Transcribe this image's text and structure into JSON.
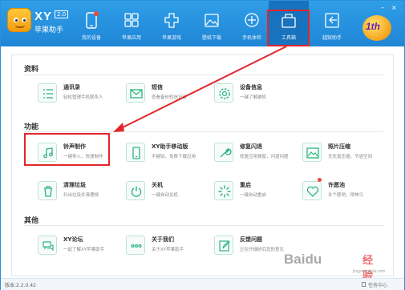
{
  "app": {
    "name": "XY",
    "version_badge": "2.0",
    "subtitle": "苹果助手",
    "mascot_text": "1th"
  },
  "nav": [
    {
      "label": "我的设备",
      "icon": "phone-icon"
    },
    {
      "label": "苹果应用",
      "icon": "apps-grid-icon"
    },
    {
      "label": "苹果游戏",
      "icon": "game-cross-icon"
    },
    {
      "label": "壁纸下载",
      "icon": "wallpaper-icon"
    },
    {
      "label": "手机体检",
      "icon": "plus-circle-icon"
    },
    {
      "label": "工具箱",
      "icon": "toolbox-icon",
      "active": true
    },
    {
      "label": "越狱助手",
      "icon": "jailbreak-icon"
    }
  ],
  "sections": {
    "data": "资料",
    "functions": "功能",
    "other": "其他"
  },
  "tiles": {
    "contacts": {
      "title": "通讯录",
      "desc": "轻松管理手机联系人",
      "icon": "list-icon"
    },
    "sms": {
      "title": "短信",
      "desc": "查看备份短信记录",
      "icon": "envelope-icon"
    },
    "device_info": {
      "title": "设备信息",
      "desc": "一键了解硬机",
      "icon": "gear-icon"
    },
    "ringtone": {
      "title": "铃声制作",
      "desc": "一键导入，快速制作",
      "icon": "music-note-icon"
    },
    "xy_mobile": {
      "title": "XY助手移动版",
      "desc": "不越狱，免费下载应用",
      "icon": "mobile-icon"
    },
    "repair": {
      "title": "修复闪退",
      "desc": "修复应用弹窗，闪退问题",
      "icon": "wrench-icon"
    },
    "photo_compress": {
      "title": "照片压缩",
      "desc": "无失真压缩，节省空间",
      "icon": "photo-icon"
    },
    "cleanup": {
      "title": "清理垃圾",
      "desc": "扫出垃圾并清理掉",
      "icon": "trash-icon"
    },
    "shutdown": {
      "title": "关机",
      "desc": "一键自动关机",
      "icon": "power-icon"
    },
    "restart": {
      "title": "重启",
      "desc": "一键自动重启",
      "icon": "loading-icon"
    },
    "wishing": {
      "title": "许愿池",
      "desc": "许个愿吧，得神马",
      "icon": "heart-icon"
    },
    "forum": {
      "title": "XY论坛",
      "desc": "一起了解XY苹果助手",
      "icon": "chat-icon"
    },
    "about": {
      "title": "关于我们",
      "desc": "关于XY苹果助手",
      "icon": "dots-icon"
    },
    "feedback": {
      "title": "反馈问题",
      "desc": "正在仔细研究您的意见",
      "icon": "edit-icon"
    }
  },
  "status": {
    "version": "版本:2.2.0.42",
    "task": "任务中心"
  },
  "watermark": {
    "text": "Baidu",
    "sub": "经验",
    "url": "jingyan.baidu.com"
  },
  "colors": {
    "header": "#2f9ee8",
    "highlight": "#e3262b",
    "tile_icon": "#2bb57e",
    "text": "#333333"
  }
}
